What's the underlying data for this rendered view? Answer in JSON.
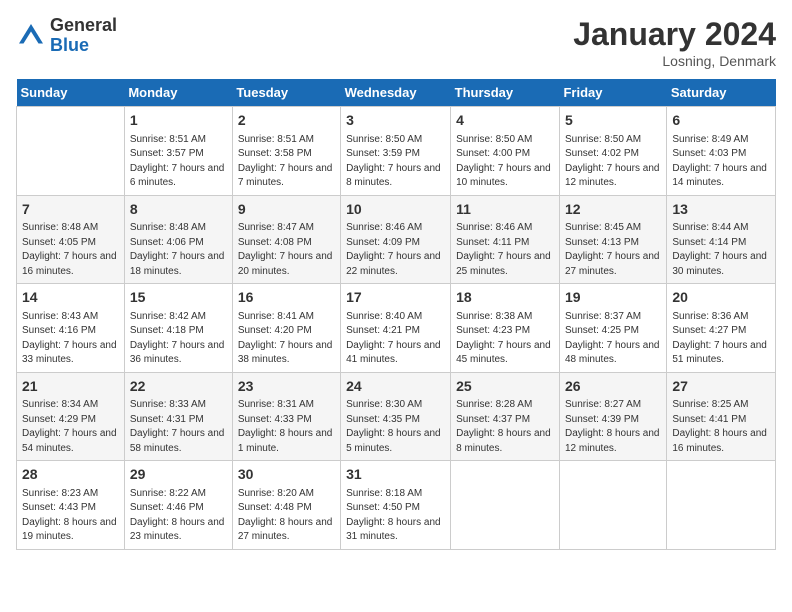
{
  "logo": {
    "general": "General",
    "blue": "Blue"
  },
  "header": {
    "month": "January 2024",
    "location": "Losning, Denmark"
  },
  "days_of_week": [
    "Sunday",
    "Monday",
    "Tuesday",
    "Wednesday",
    "Thursday",
    "Friday",
    "Saturday"
  ],
  "weeks": [
    [
      {
        "day": "",
        "sunrise": "",
        "sunset": "",
        "daylight": ""
      },
      {
        "day": "1",
        "sunrise": "Sunrise: 8:51 AM",
        "sunset": "Sunset: 3:57 PM",
        "daylight": "Daylight: 7 hours and 6 minutes."
      },
      {
        "day": "2",
        "sunrise": "Sunrise: 8:51 AM",
        "sunset": "Sunset: 3:58 PM",
        "daylight": "Daylight: 7 hours and 7 minutes."
      },
      {
        "day": "3",
        "sunrise": "Sunrise: 8:50 AM",
        "sunset": "Sunset: 3:59 PM",
        "daylight": "Daylight: 7 hours and 8 minutes."
      },
      {
        "day": "4",
        "sunrise": "Sunrise: 8:50 AM",
        "sunset": "Sunset: 4:00 PM",
        "daylight": "Daylight: 7 hours and 10 minutes."
      },
      {
        "day": "5",
        "sunrise": "Sunrise: 8:50 AM",
        "sunset": "Sunset: 4:02 PM",
        "daylight": "Daylight: 7 hours and 12 minutes."
      },
      {
        "day": "6",
        "sunrise": "Sunrise: 8:49 AM",
        "sunset": "Sunset: 4:03 PM",
        "daylight": "Daylight: 7 hours and 14 minutes."
      }
    ],
    [
      {
        "day": "7",
        "sunrise": "Sunrise: 8:48 AM",
        "sunset": "Sunset: 4:05 PM",
        "daylight": "Daylight: 7 hours and 16 minutes."
      },
      {
        "day": "8",
        "sunrise": "Sunrise: 8:48 AM",
        "sunset": "Sunset: 4:06 PM",
        "daylight": "Daylight: 7 hours and 18 minutes."
      },
      {
        "day": "9",
        "sunrise": "Sunrise: 8:47 AM",
        "sunset": "Sunset: 4:08 PM",
        "daylight": "Daylight: 7 hours and 20 minutes."
      },
      {
        "day": "10",
        "sunrise": "Sunrise: 8:46 AM",
        "sunset": "Sunset: 4:09 PM",
        "daylight": "Daylight: 7 hours and 22 minutes."
      },
      {
        "day": "11",
        "sunrise": "Sunrise: 8:46 AM",
        "sunset": "Sunset: 4:11 PM",
        "daylight": "Daylight: 7 hours and 25 minutes."
      },
      {
        "day": "12",
        "sunrise": "Sunrise: 8:45 AM",
        "sunset": "Sunset: 4:13 PM",
        "daylight": "Daylight: 7 hours and 27 minutes."
      },
      {
        "day": "13",
        "sunrise": "Sunrise: 8:44 AM",
        "sunset": "Sunset: 4:14 PM",
        "daylight": "Daylight: 7 hours and 30 minutes."
      }
    ],
    [
      {
        "day": "14",
        "sunrise": "Sunrise: 8:43 AM",
        "sunset": "Sunset: 4:16 PM",
        "daylight": "Daylight: 7 hours and 33 minutes."
      },
      {
        "day": "15",
        "sunrise": "Sunrise: 8:42 AM",
        "sunset": "Sunset: 4:18 PM",
        "daylight": "Daylight: 7 hours and 36 minutes."
      },
      {
        "day": "16",
        "sunrise": "Sunrise: 8:41 AM",
        "sunset": "Sunset: 4:20 PM",
        "daylight": "Daylight: 7 hours and 38 minutes."
      },
      {
        "day": "17",
        "sunrise": "Sunrise: 8:40 AM",
        "sunset": "Sunset: 4:21 PM",
        "daylight": "Daylight: 7 hours and 41 minutes."
      },
      {
        "day": "18",
        "sunrise": "Sunrise: 8:38 AM",
        "sunset": "Sunset: 4:23 PM",
        "daylight": "Daylight: 7 hours and 45 minutes."
      },
      {
        "day": "19",
        "sunrise": "Sunrise: 8:37 AM",
        "sunset": "Sunset: 4:25 PM",
        "daylight": "Daylight: 7 hours and 48 minutes."
      },
      {
        "day": "20",
        "sunrise": "Sunrise: 8:36 AM",
        "sunset": "Sunset: 4:27 PM",
        "daylight": "Daylight: 7 hours and 51 minutes."
      }
    ],
    [
      {
        "day": "21",
        "sunrise": "Sunrise: 8:34 AM",
        "sunset": "Sunset: 4:29 PM",
        "daylight": "Daylight: 7 hours and 54 minutes."
      },
      {
        "day": "22",
        "sunrise": "Sunrise: 8:33 AM",
        "sunset": "Sunset: 4:31 PM",
        "daylight": "Daylight: 7 hours and 58 minutes."
      },
      {
        "day": "23",
        "sunrise": "Sunrise: 8:31 AM",
        "sunset": "Sunset: 4:33 PM",
        "daylight": "Daylight: 8 hours and 1 minute."
      },
      {
        "day": "24",
        "sunrise": "Sunrise: 8:30 AM",
        "sunset": "Sunset: 4:35 PM",
        "daylight": "Daylight: 8 hours and 5 minutes."
      },
      {
        "day": "25",
        "sunrise": "Sunrise: 8:28 AM",
        "sunset": "Sunset: 4:37 PM",
        "daylight": "Daylight: 8 hours and 8 minutes."
      },
      {
        "day": "26",
        "sunrise": "Sunrise: 8:27 AM",
        "sunset": "Sunset: 4:39 PM",
        "daylight": "Daylight: 8 hours and 12 minutes."
      },
      {
        "day": "27",
        "sunrise": "Sunrise: 8:25 AM",
        "sunset": "Sunset: 4:41 PM",
        "daylight": "Daylight: 8 hours and 16 minutes."
      }
    ],
    [
      {
        "day": "28",
        "sunrise": "Sunrise: 8:23 AM",
        "sunset": "Sunset: 4:43 PM",
        "daylight": "Daylight: 8 hours and 19 minutes."
      },
      {
        "day": "29",
        "sunrise": "Sunrise: 8:22 AM",
        "sunset": "Sunset: 4:46 PM",
        "daylight": "Daylight: 8 hours and 23 minutes."
      },
      {
        "day": "30",
        "sunrise": "Sunrise: 8:20 AM",
        "sunset": "Sunset: 4:48 PM",
        "daylight": "Daylight: 8 hours and 27 minutes."
      },
      {
        "day": "31",
        "sunrise": "Sunrise: 8:18 AM",
        "sunset": "Sunset: 4:50 PM",
        "daylight": "Daylight: 8 hours and 31 minutes."
      },
      {
        "day": "",
        "sunrise": "",
        "sunset": "",
        "daylight": ""
      },
      {
        "day": "",
        "sunrise": "",
        "sunset": "",
        "daylight": ""
      },
      {
        "day": "",
        "sunrise": "",
        "sunset": "",
        "daylight": ""
      }
    ]
  ]
}
